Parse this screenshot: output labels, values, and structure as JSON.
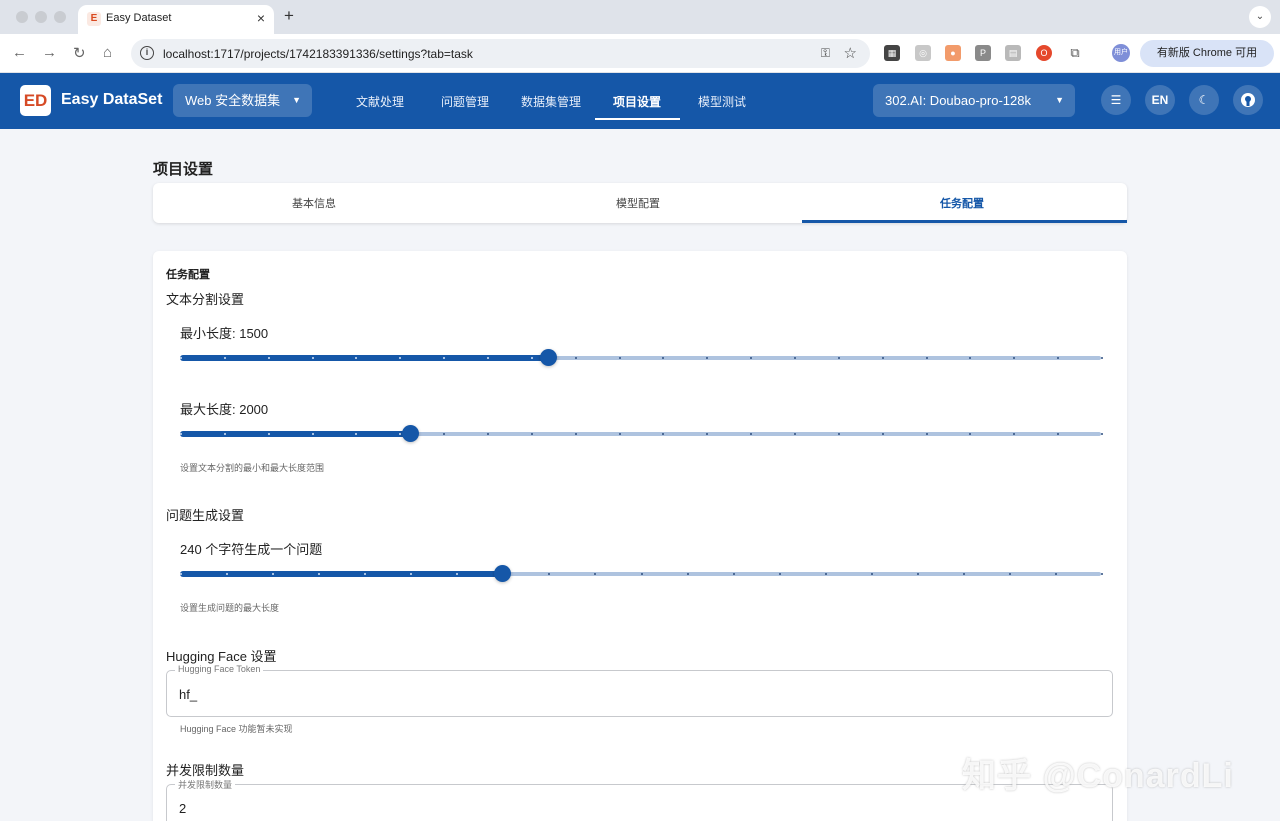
{
  "browser": {
    "tab_title": "Easy Dataset",
    "tab_favicon": "E",
    "close_glyph": "×",
    "new_tab_glyph": "+",
    "url": "localhost:1717/projects/1742183391336/settings?tab=task",
    "update_label": "有新版 Chrome 可用",
    "profile_label": "用户"
  },
  "app": {
    "brand": "Easy DataSet",
    "logo_glyph": "ED",
    "project_selector": "Web 安全数据集",
    "nav": [
      "文献处理",
      "问题管理",
      "数据集管理",
      "项目设置",
      "模型测试"
    ],
    "active_nav": "项目设置",
    "model_selector": "302.AI: Doubao-pro-128k",
    "lang_button": "EN",
    "accent_color": "#1557a8"
  },
  "settings": {
    "page_title": "项目设置",
    "tabs": [
      "基本信息",
      "模型配置",
      "任务配置"
    ],
    "active_tab": "任务配置",
    "card_title": "任务配置",
    "text_split": {
      "title": "文本分割设置",
      "min_label": "最小长度: 1500",
      "min_fraction": 0.4,
      "max_label": "最大长度: 2000",
      "max_fraction": 0.25,
      "helper": "设置文本分割的最小和最大长度范围"
    },
    "question_gen": {
      "title": "问题生成设置",
      "label": "240 个字符生成一个问题",
      "fraction": 0.35,
      "helper": "设置生成问题的最大长度"
    },
    "huggingface": {
      "title": "Hugging Face 设置",
      "field_label": "Hugging Face Token",
      "value": "hf_",
      "helper": "Hugging Face 功能暂未实现"
    },
    "concurrency": {
      "title": "并发限制数量",
      "field_label": "并发限制数量",
      "value": "2"
    }
  },
  "watermark": "知乎 @ConardLi"
}
